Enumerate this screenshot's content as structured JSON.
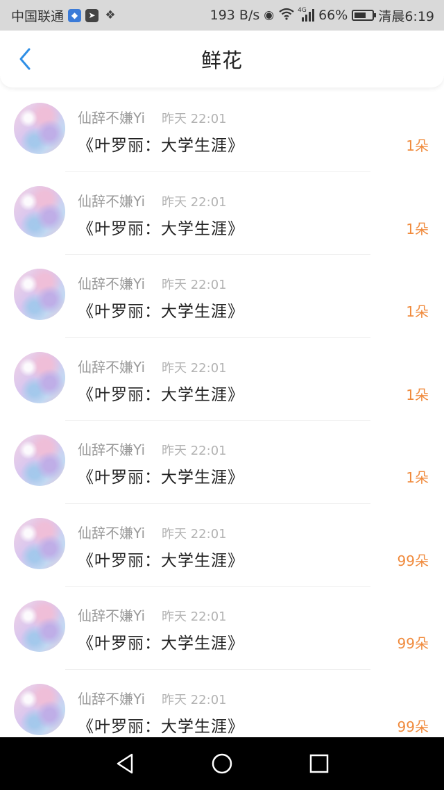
{
  "status_bar": {
    "carrier": "中国联通",
    "speed": "193 B/s",
    "network": "4G",
    "battery": "66%",
    "battery_level": 0.66,
    "time": "清晨6:19"
  },
  "header": {
    "title": "鲜花"
  },
  "items": [
    {
      "username": "仙辞不嫌Yi",
      "time": "昨天 22:01",
      "book": "《叶罗丽：大学生涯》",
      "count": "1朵"
    },
    {
      "username": "仙辞不嫌Yi",
      "time": "昨天 22:01",
      "book": "《叶罗丽：大学生涯》",
      "count": "1朵"
    },
    {
      "username": "仙辞不嫌Yi",
      "time": "昨天 22:01",
      "book": "《叶罗丽：大学生涯》",
      "count": "1朵"
    },
    {
      "username": "仙辞不嫌Yi",
      "time": "昨天 22:01",
      "book": "《叶罗丽：大学生涯》",
      "count": "1朵"
    },
    {
      "username": "仙辞不嫌Yi",
      "time": "昨天 22:01",
      "book": "《叶罗丽：大学生涯》",
      "count": "1朵"
    },
    {
      "username": "仙辞不嫌Yi",
      "time": "昨天 22:01",
      "book": "《叶罗丽：大学生涯》",
      "count": "99朵"
    },
    {
      "username": "仙辞不嫌Yi",
      "time": "昨天 22:01",
      "book": "《叶罗丽：大学生涯》",
      "count": "99朵"
    },
    {
      "username": "仙辞不嫌Yi",
      "time": "昨天 22:01",
      "book": "《叶罗丽：大学生涯》",
      "count": "99朵"
    }
  ],
  "colors": {
    "accent": "#2f8fe6",
    "count": "#f08a3c"
  }
}
